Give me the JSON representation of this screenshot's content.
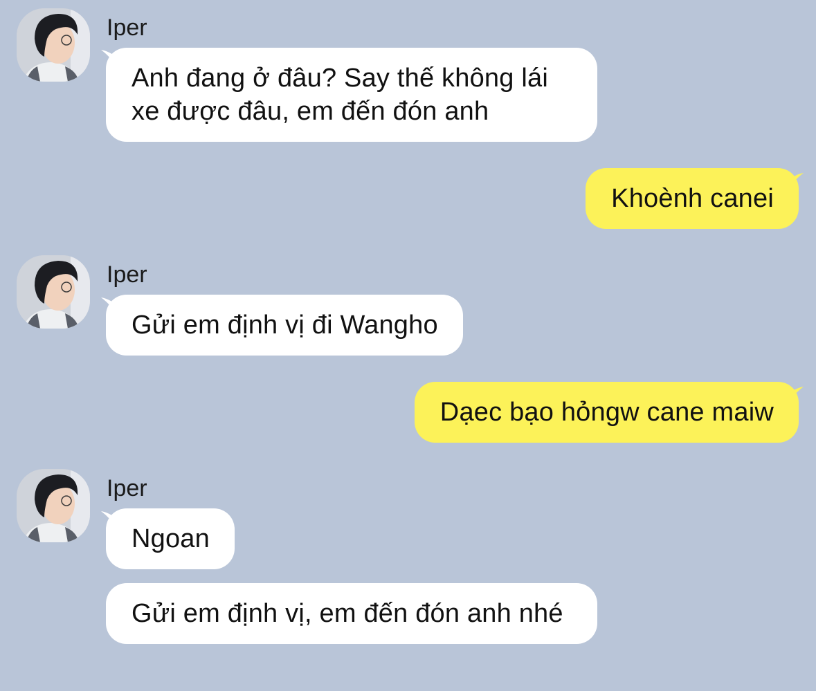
{
  "contact": {
    "name": "Iper"
  },
  "colors": {
    "background": "#b9c5d8",
    "incoming_bubble": "#ffffff",
    "outgoing_bubble": "#fcf259"
  },
  "messages": [
    {
      "direction": "incoming",
      "sender": "Iper",
      "text": "Anh đang ở đâu? Say thế không lái xe được đâu, em đến đón anh"
    },
    {
      "direction": "outgoing",
      "text": "Khoènh canei"
    },
    {
      "direction": "incoming",
      "sender": "Iper",
      "text": "Gửi em định vị đi Wangho"
    },
    {
      "direction": "outgoing",
      "text": "Dạec bạo hỏngw cane maiw"
    },
    {
      "direction": "incoming",
      "sender": "Iper",
      "text": "Ngoan"
    },
    {
      "direction": "incoming",
      "text": "Gửi em định vị, em đến đón anh nhé"
    }
  ]
}
